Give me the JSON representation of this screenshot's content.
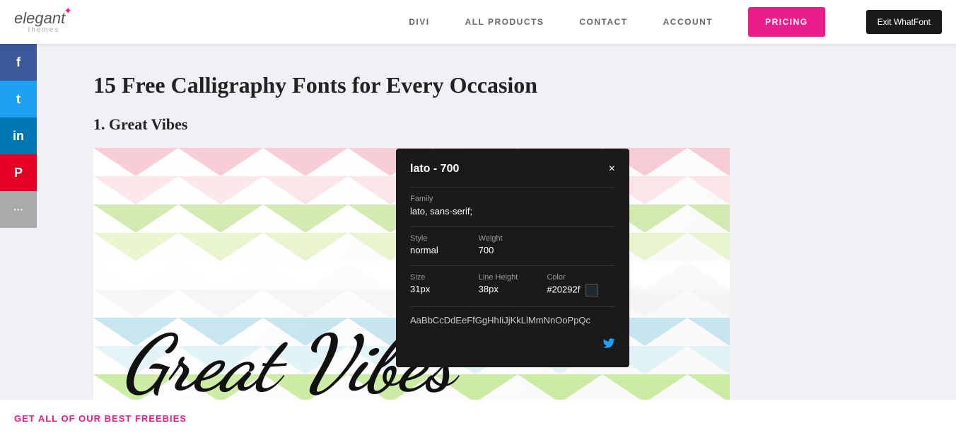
{
  "header": {
    "logo_text": "elegant",
    "logo_sub": "themes",
    "logo_star": "✦",
    "nav": {
      "items": [
        {
          "label": "DIVI",
          "id": "divi"
        },
        {
          "label": "ALL PRODUCTS",
          "id": "all-products"
        },
        {
          "label": "CONTACT",
          "id": "contact"
        },
        {
          "label": "ACCOUNT",
          "id": "account"
        }
      ]
    },
    "pricing_btn": "PRICING",
    "exit_whatfont_btn": "Exit WhatFont"
  },
  "social": {
    "buttons": [
      {
        "label": "f",
        "platform": "facebook"
      },
      {
        "label": "t",
        "platform": "twitter"
      },
      {
        "label": "in",
        "platform": "linkedin"
      },
      {
        "label": "P",
        "platform": "pinterest"
      },
      {
        "label": "...",
        "platform": "more"
      }
    ]
  },
  "article": {
    "page_title": "15 Free Calligraphy Fonts for Every Occasion",
    "section_title": "1. Great Vibes",
    "font_preview": "Great Vibes"
  },
  "whatfont_popup": {
    "title": "lato - 700",
    "close": "×",
    "family_label": "Family",
    "family_value": "lato, sans-serif;",
    "style_label": "Style",
    "style_value": "normal",
    "weight_label": "Weight",
    "weight_value": "700",
    "size_label": "Size",
    "size_value": "31px",
    "line_height_label": "Line Height",
    "line_height_value": "38px",
    "color_label": "Color",
    "color_value": "#20292f",
    "color_hex": "#20292f",
    "alphabet": "AaBbCcDdEeFfGgHhIiJjKkLlMmNnOoPpQc"
  },
  "bottom_banner": {
    "text": "GET ALL OF OUR BEST FREEBIES"
  }
}
